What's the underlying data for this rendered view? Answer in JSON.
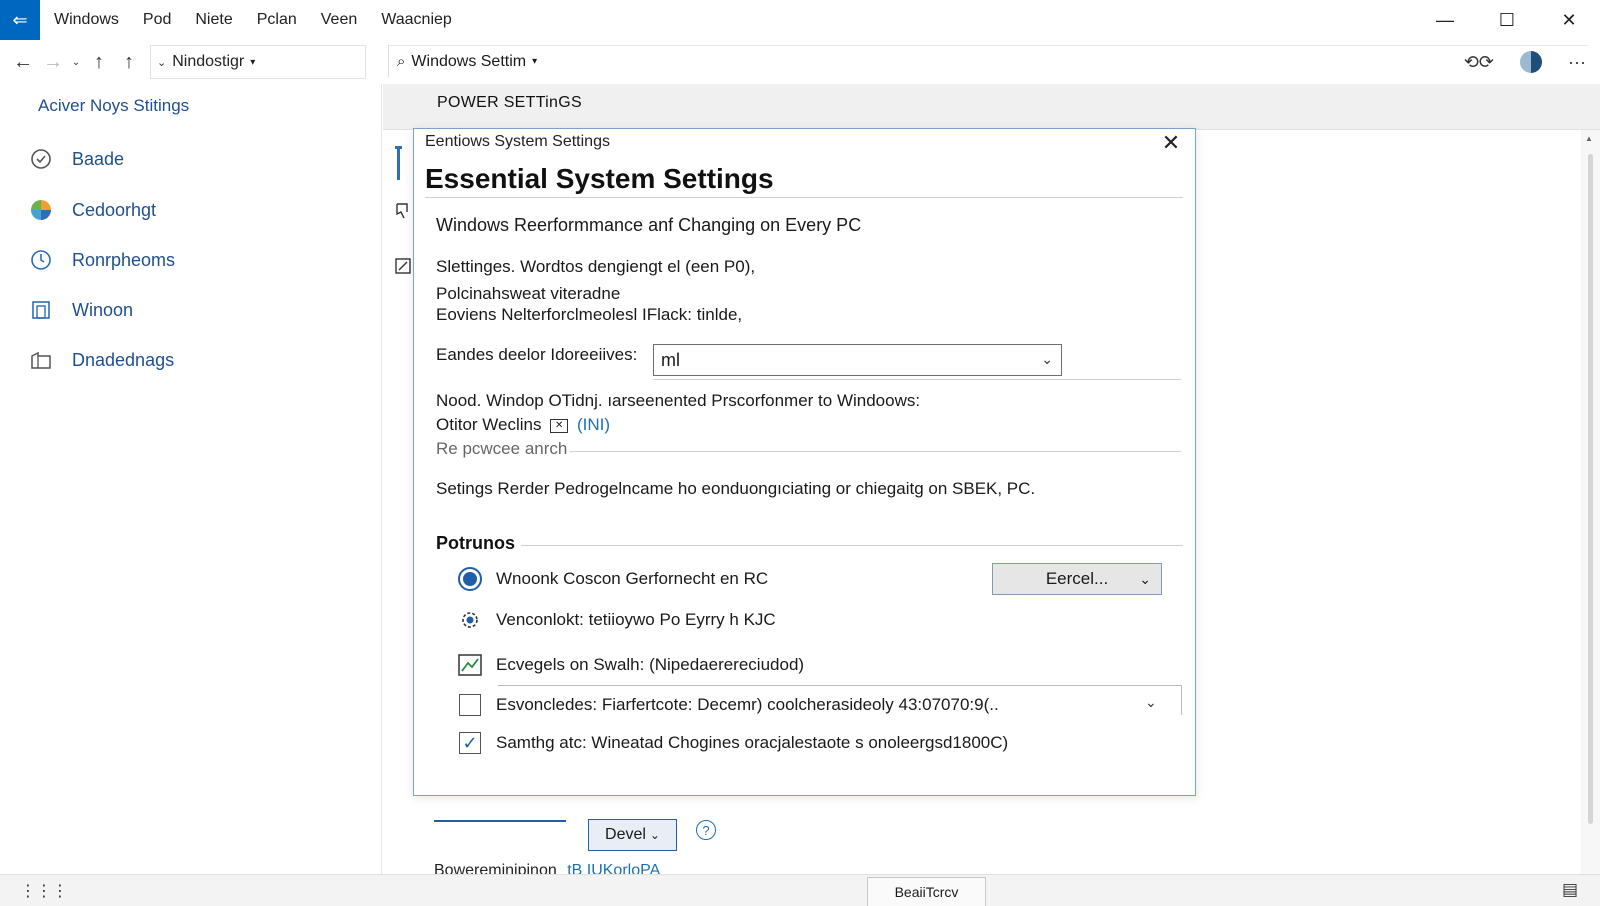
{
  "window": {
    "menu": [
      "Windows",
      "Pod",
      "Niete",
      "Pclan",
      "Veen",
      "Waacniep"
    ],
    "controls": {
      "minimize": "—",
      "maximize": "☐",
      "close": "✕"
    }
  },
  "address": {
    "breadcrumb": "Nindostigr",
    "search": "Windows Settim"
  },
  "sidebar": {
    "title": "Aciver Noys Stitings",
    "items": [
      {
        "label": "Baade",
        "icon": "clock-icon"
      },
      {
        "label": "Cedoorhgt",
        "icon": "color-pinwheel-icon"
      },
      {
        "label": "Ronrpheoms",
        "icon": "power-cycle-icon"
      },
      {
        "label": "Winoon",
        "icon": "window-icon"
      },
      {
        "label": "Dnadednags",
        "icon": "folder-icon"
      }
    ]
  },
  "main": {
    "header": "POWER SETTinGS"
  },
  "dialog": {
    "caption": "Eentiows System Settings",
    "heading": "Essential System Settings",
    "subtitle": "Windows Reerformmance anf Changing on Every PC",
    "line1": "Slettinges. Wordtos dengiengt el (een P0),",
    "line2": "Polcinahsweat viteradne",
    "line3": "Eoviens Nelterforclmeolesl IFlack: tinlde,",
    "select_label": "Eandes deelor Idoreeiives:",
    "select_value": "ml",
    "note1": "Nood. Windop OTidnj. ıarseenented Prscorfonmer to Windoows:",
    "note2_text": "Otitor Weclins",
    "note2_link": "(INI)",
    "note3": "Re pcwcee anrch",
    "note4": "Setings Rerder Pedrogelncame ho eonduongıciating or chiegaitg on SBEK, PC.",
    "section": "Potrunos",
    "options": [
      {
        "label": "Wnoonk Coscon Gerfornecht en RC",
        "control": "radio-selected"
      },
      {
        "label": "Venconlokt: tetiioywo Po Eyrry h KJC",
        "control": "gear-bolt-icon"
      },
      {
        "label": "Ecvegels on Swalh:  (Nipedaerereciudod)",
        "control": "chart-icon"
      },
      {
        "label": "Esvoncledes: Fiarfertcote: Decemr) coolcherasideoly 43:07070:9(..",
        "control": "checkbox-unchecked"
      },
      {
        "label": "Samthg atc: Wineatad Chogines oracjalestaote s onoleergsd1800C)",
        "control": "checkbox-checked"
      }
    ],
    "option_button": "Eercel..."
  },
  "footer_controls": {
    "devel_button": "Devel",
    "bottom_text": "Bowereminipinon",
    "bottom_link": "tB IUKorloPA"
  },
  "statusbar": {
    "tab": "BeaiiTcrcv"
  },
  "colors": {
    "accent": "#0067c0",
    "sidebar_text": "#1f4f8f",
    "radio": "#1f5ea8"
  }
}
